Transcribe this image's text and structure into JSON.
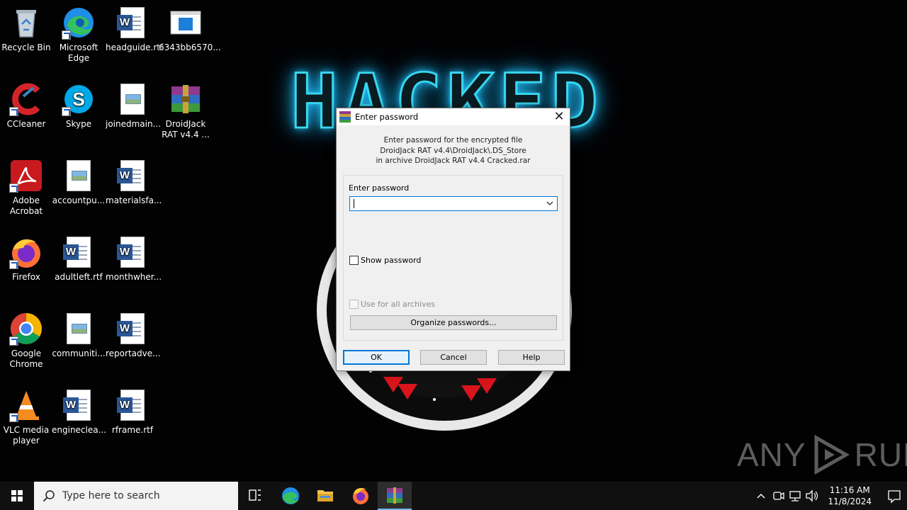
{
  "wallpaper": {
    "headline": "HACKED",
    "watermark_left": "ANY",
    "watermark_right": "RUN"
  },
  "desktop": {
    "icons": [
      {
        "label": "Recycle Bin",
        "icon": "recycle-bin-icon"
      },
      {
        "label": "Microsoft Edge",
        "icon": "edge-icon"
      },
      {
        "label": "headguide.rtf",
        "icon": "word-doc-icon"
      },
      {
        "label": "6343bb6570...",
        "icon": "window-app-icon"
      },
      {
        "label": "CCleaner",
        "icon": "ccleaner-icon"
      },
      {
        "label": "Skype",
        "icon": "skype-icon"
      },
      {
        "label": "joinedmain...",
        "icon": "image-doc-icon"
      },
      {
        "label": "DroidJack RAT v4.4 ...",
        "icon": "winrar-icon"
      },
      {
        "label": "Adobe Acrobat",
        "icon": "acrobat-icon"
      },
      {
        "label": "accountpu...",
        "icon": "image-doc-icon"
      },
      {
        "label": "materialsfa...",
        "icon": "word-doc-icon"
      },
      {
        "label": "Firefox",
        "icon": "firefox-icon"
      },
      {
        "label": "adultleft.rtf",
        "icon": "word-doc-icon"
      },
      {
        "label": "monthwher...",
        "icon": "word-doc-icon"
      },
      {
        "label": "Google Chrome",
        "icon": "chrome-icon"
      },
      {
        "label": "communiti...",
        "icon": "image-doc-icon"
      },
      {
        "label": "reportadve...",
        "icon": "word-doc-icon"
      },
      {
        "label": "VLC media player",
        "icon": "vlc-icon"
      },
      {
        "label": "engineclea...",
        "icon": "word-doc-icon"
      },
      {
        "label": "rframe.rtf",
        "icon": "word-doc-icon"
      }
    ]
  },
  "dialog": {
    "title": "Enter password",
    "info_line1": "Enter password for the encrypted file",
    "info_line2": "DroidJack RAT v4.4\\DroidJack\\.DS_Store",
    "info_line3": "in archive DroidJack RAT v4.4 Cracked.rar",
    "password_label": "Enter password",
    "password_value": "",
    "show_password_label": "Show password",
    "use_all_label": "Use for all archives",
    "organize_label": "Organize passwords...",
    "ok_label": "OK",
    "cancel_label": "Cancel",
    "help_label": "Help",
    "close_glyph": "✕"
  },
  "taskbar": {
    "search_placeholder": "Type here to search",
    "time": "11:16 AM",
    "date": "11/8/2024",
    "accent": "#76b9ed"
  }
}
